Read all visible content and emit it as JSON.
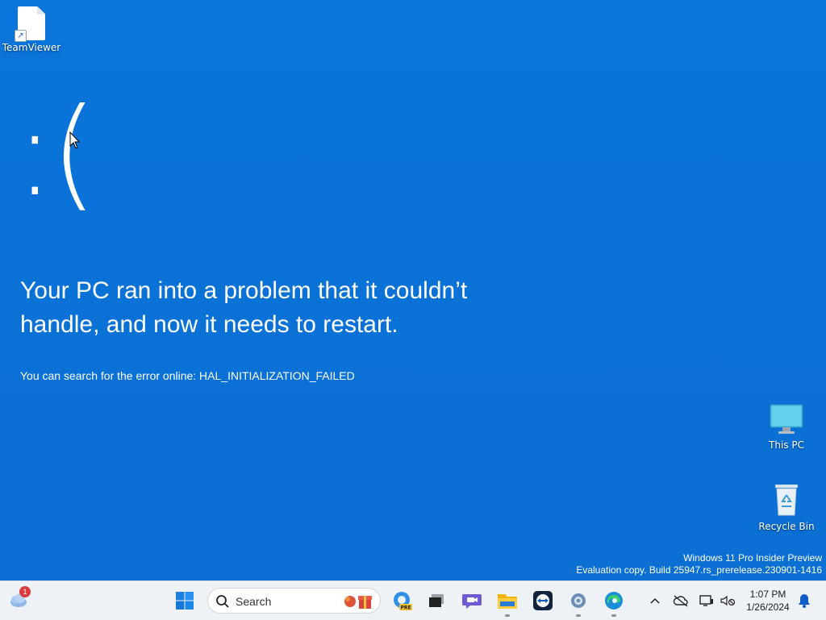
{
  "desktop": {
    "icons": [
      {
        "name": "TeamViewer"
      },
      {
        "name": "This PC"
      },
      {
        "name": "Recycle Bin"
      }
    ]
  },
  "bsod": {
    "face": ":(",
    "heading": "Your PC ran into a problem that it couldn’t handle, and now it needs to restart.",
    "subtext": "You can search for the error online: HAL_INITIALIZATION_FAILED"
  },
  "watermark": {
    "line1": "Windows 11 Pro Insider Preview",
    "line2": "Evaluation copy. Build 25947.rs_prerelease.230901-1416"
  },
  "taskbar": {
    "widgets_badge": "1",
    "search_placeholder": "Search",
    "apps": [
      "copilot-pre",
      "task-view",
      "meet",
      "file-explorer",
      "teamviewer",
      "settings",
      "edge"
    ],
    "clock_time": "1:07 PM",
    "clock_date": "1/26/2024"
  },
  "colors": {
    "desktop_bg": "#0b72d9",
    "taskbar_bg": "#eef1f6",
    "text": "#ffffff"
  }
}
